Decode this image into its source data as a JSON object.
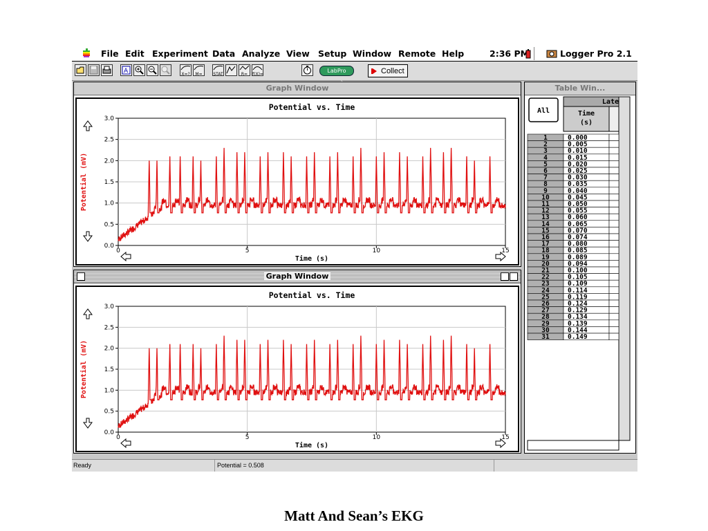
{
  "menubar": {
    "apple_icon": "apple-icon",
    "items": [
      "File",
      "Edit",
      "Experiment",
      "Data",
      "Analyze",
      "View",
      "Setup",
      "Window",
      "Remote",
      "Help"
    ],
    "clock": "2:36 PM",
    "app_name": "Logger Pro 2.1"
  },
  "toolbar": {
    "icons": [
      "open-folder-icon",
      "save-disk-icon",
      "print-icon",
      "autoscale-icon",
      "zoom-in-icon",
      "zoom-out-icon",
      "undo-zoom-icon",
      "examine-icon",
      "slope-icon",
      "statistics-icon",
      "integral-icon",
      "tangent-icon",
      "curve-fit-icon",
      "stopwatch-icon"
    ],
    "examine_label": "X=?",
    "slope_label": "M=",
    "stats_label": "STAT",
    "integral_label": "R=",
    "curvefit_label": "f(X)=",
    "labpro_label": "LabPro",
    "collect_label": "Collect"
  },
  "graph_window_1": {
    "title": "Graph Window",
    "chart_title": "Potential vs. Time",
    "xlabel": "Time (s)",
    "ylabel": "Potential (mV)"
  },
  "graph_window_2": {
    "title": "Graph Window",
    "chart_title": "Potential vs. Time",
    "xlabel": "Time (s)",
    "ylabel": "Potential (mV)"
  },
  "chart_data": [
    {
      "type": "line",
      "title": "Potential vs. Time",
      "xlabel": "Time (s)",
      "ylabel": "Potential (mV)",
      "xlim": [
        0,
        15
      ],
      "ylim": [
        0,
        3.0
      ],
      "x_ticks": [
        "0",
        "5",
        "10",
        "15"
      ],
      "y_ticks": [
        "0.0",
        "0.5",
        "1.0",
        "1.5",
        "2.0",
        "2.5",
        "3.0"
      ],
      "grid": true,
      "color": "#e01010",
      "series": [
        {
          "baseline": 0.95,
          "peak_times": [
            1.2,
            1.5,
            2.0,
            2.4,
            2.9,
            3.2,
            3.8,
            4.1,
            4.6,
            4.9,
            5.5,
            5.8,
            6.4,
            6.7,
            7.3,
            7.6,
            8.2,
            8.5,
            9.1,
            9.4,
            10.0,
            10.3,
            10.9,
            11.2,
            11.8,
            12.1,
            12.6,
            12.9,
            13.5,
            13.8,
            14.4
          ],
          "peak_values": [
            2.0,
            2.0,
            2.1,
            2.1,
            2.1,
            2.0,
            2.1,
            2.3,
            2.2,
            2.2,
            2.1,
            2.2,
            2.2,
            2.1,
            2.1,
            2.2,
            2.1,
            2.2,
            2.1,
            2.3,
            2.1,
            2.2,
            2.2,
            2.1,
            2.1,
            2.3,
            2.2,
            2.3,
            2.1,
            2.0,
            2.1
          ]
        }
      ]
    },
    {
      "type": "line",
      "title": "Potential vs. Time",
      "xlabel": "Time (s)",
      "ylabel": "Potential (mV)",
      "xlim": [
        0,
        15
      ],
      "ylim": [
        0,
        3.0
      ],
      "x_ticks": [
        "0",
        "5",
        "10",
        "15"
      ],
      "y_ticks": [
        "0.0",
        "0.5",
        "1.0",
        "1.5",
        "2.0",
        "2.5",
        "3.0"
      ],
      "grid": true,
      "color": "#e01010",
      "series": [
        {
          "baseline": 0.95,
          "peak_times": [
            1.2,
            1.5,
            2.0,
            2.4,
            2.9,
            3.2,
            3.8,
            4.1,
            4.6,
            4.9,
            5.5,
            5.8,
            6.4,
            6.7,
            7.3,
            7.6,
            8.2,
            8.5,
            9.1,
            9.4,
            10.0,
            10.3,
            10.9,
            11.2,
            11.8,
            12.1,
            12.6,
            12.9,
            13.5,
            13.8,
            14.4
          ],
          "peak_values": [
            2.0,
            2.0,
            2.1,
            2.1,
            2.1,
            2.0,
            2.1,
            2.3,
            2.2,
            2.2,
            2.1,
            2.2,
            2.2,
            2.1,
            2.1,
            2.2,
            2.1,
            2.2,
            2.1,
            2.3,
            2.1,
            2.2,
            2.2,
            2.1,
            2.1,
            2.3,
            2.2,
            2.3,
            2.1,
            2.0,
            2.1
          ]
        }
      ]
    }
  ],
  "table_window": {
    "title": "Table Win...",
    "all_button": "All",
    "dataset_header": "Late",
    "column_header_line1": "Time",
    "column_header_line2": "(s)",
    "rows": [
      "1",
      "2",
      "3",
      "4",
      "5",
      "6",
      "7",
      "8",
      "9",
      "10",
      "11",
      "12",
      "13",
      "14",
      "15",
      "16",
      "17",
      "18",
      "19",
      "20",
      "21",
      "22",
      "23",
      "24",
      "25",
      "26",
      "27",
      "28",
      "29",
      "30",
      "31"
    ],
    "values": [
      "0.000",
      "0.005",
      "0.010",
      "0.015",
      "0.020",
      "0.025",
      "0.030",
      "0.035",
      "0.040",
      "0.045",
      "0.050",
      "0.055",
      "0.060",
      "0.065",
      "0.070",
      "0.074",
      "0.080",
      "0.085",
      "0.089",
      "0.094",
      "0.100",
      "0.105",
      "0.109",
      "0.114",
      "0.119",
      "0.124",
      "0.129",
      "0.134",
      "0.139",
      "0.144",
      "0.149"
    ]
  },
  "status": {
    "left": "Ready",
    "readout": "Potential = 0.508"
  },
  "caption": "Matt And Sean’s EKG"
}
